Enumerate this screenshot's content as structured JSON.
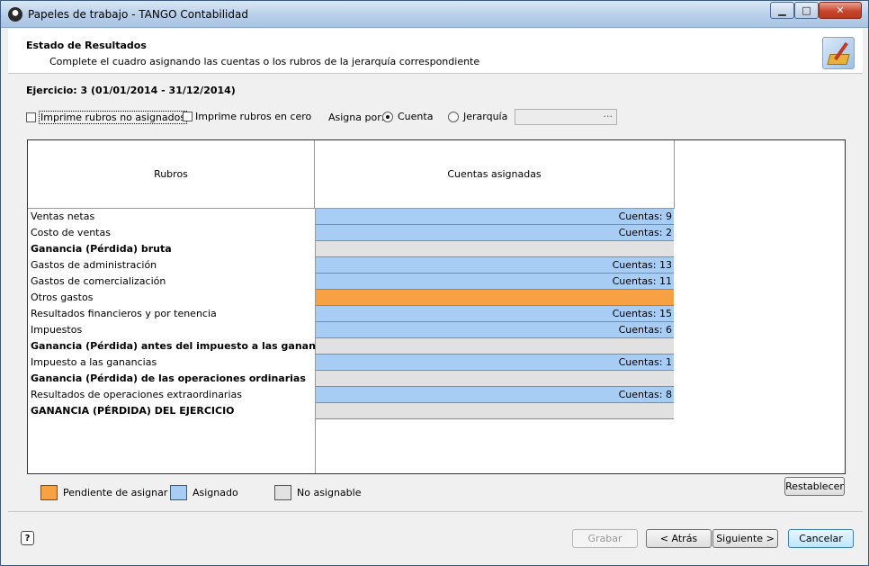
{
  "window": {
    "title": "Papeles de trabajo - TANGO Contabilidad",
    "controls": {
      "minimize": "▁",
      "maximize": "□",
      "close": "✕"
    },
    "icons": {
      "app": "tango-app-icon",
      "header": "wizard-icon",
      "help": "help-icon"
    }
  },
  "header": {
    "title": "Estado de Resultados",
    "subtitle": "Complete el cuadro asignando las cuentas o los rubros de la jerarquía correspondiente"
  },
  "ejercicio": "Ejercicio: 3 (01/01/2014 - 31/12/2014)",
  "options": {
    "imprime_no_asignados": {
      "label": "Imprime rubros no asignados",
      "checked": false
    },
    "imprime_en_cero": {
      "label": "Imprime rubros en cero",
      "checked": false
    },
    "asigna_por_label": "Asigna por:",
    "radio_cuenta": {
      "label": "Cuenta",
      "selected": true
    },
    "radio_jerarquia": {
      "label": "Jerarquía",
      "selected": false
    },
    "jerarquia_button": "···"
  },
  "grid": {
    "headers": {
      "rubros": "Rubros",
      "cuentas": "Cuentas asignadas"
    },
    "rows": [
      {
        "name": "Ventas netas",
        "bold": false,
        "status": "asignado",
        "value": "Cuentas: 9"
      },
      {
        "name": "Costo de ventas",
        "bold": false,
        "status": "asignado",
        "value": "Cuentas: 2"
      },
      {
        "name": "Ganancia (Pérdida) bruta",
        "bold": true,
        "status": "noasig",
        "value": ""
      },
      {
        "name": "Gastos de administración",
        "bold": false,
        "status": "asignado",
        "value": "Cuentas: 13"
      },
      {
        "name": "Gastos de comercialización",
        "bold": false,
        "status": "asignado",
        "value": "Cuentas: 11"
      },
      {
        "name": "Otros gastos",
        "bold": false,
        "status": "pendiente",
        "value": ""
      },
      {
        "name": "Resultados financieros y por tenencia",
        "bold": false,
        "status": "asignado",
        "value": "Cuentas: 15"
      },
      {
        "name": "Impuestos",
        "bold": false,
        "status": "asignado",
        "value": "Cuentas: 6"
      },
      {
        "name": "Ganancia (Pérdida) antes del impuesto a las ganancias",
        "bold": true,
        "status": "noasig",
        "value": ""
      },
      {
        "name": "Impuesto a las ganancias",
        "bold": false,
        "status": "asignado",
        "value": "Cuentas: 1"
      },
      {
        "name": "Ganancia (Pérdida) de las operaciones ordinarias",
        "bold": true,
        "status": "noasig",
        "value": ""
      },
      {
        "name": "Resultados de operaciones extraordinarias",
        "bold": false,
        "status": "asignado",
        "value": "Cuentas: 8"
      },
      {
        "name": "GANANCIA (PÉRDIDA) DEL EJERCICIO",
        "bold": true,
        "status": "noasig",
        "value": ""
      }
    ]
  },
  "legend": {
    "pendiente": {
      "label": "Pendiente de asignar",
      "color": "#f8a143"
    },
    "asignado": {
      "label": "Asignado",
      "color": "#a7cdf5"
    },
    "noasig": {
      "label": "No asignable",
      "color": "#e1e1e1"
    }
  },
  "buttons": {
    "restablecer": "Restablecer",
    "grabar": "Grabar",
    "atras": "< Atrás",
    "siguiente": "Siguiente >",
    "cancelar": "Cancelar",
    "help": "?"
  }
}
